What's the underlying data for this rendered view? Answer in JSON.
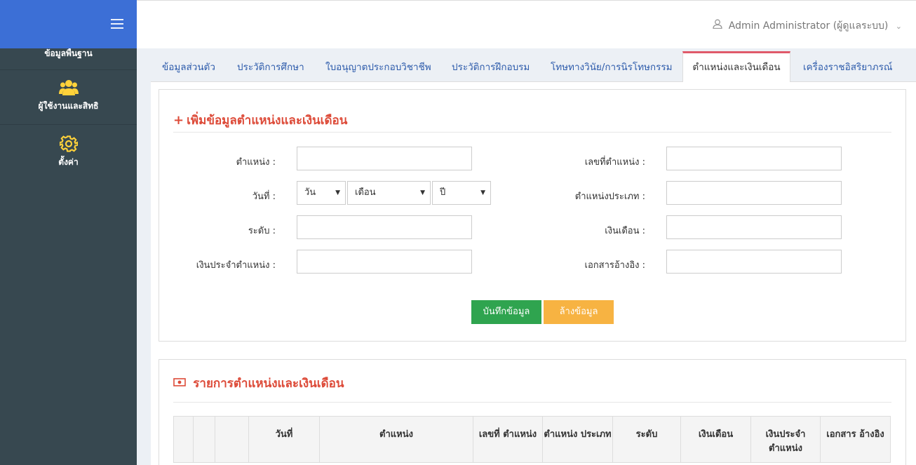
{
  "sidebar": {
    "items": [
      {
        "label": "ข้อมูลพื้นฐาน",
        "icon": "database-icon"
      },
      {
        "label": "ผู้ใช้งานและสิทธิ",
        "icon": "users-icon"
      },
      {
        "label": "ตั้งค่า",
        "icon": "gear-icon"
      }
    ]
  },
  "header": {
    "user_label": "Admin Administrator (ผู้ดูแลระบบ)"
  },
  "tabs": [
    {
      "label": "ข้อมูลส่วนตัว"
    },
    {
      "label": "ประวัติการศึกษา"
    },
    {
      "label": "ใบอนุญาตประกอบวิชาชีพ"
    },
    {
      "label": "ประวัติการฝึกอบรม"
    },
    {
      "label": "โทษทางวินัย/การนิรโทษกรรม"
    },
    {
      "label": "ตำแหน่งและเงินเดือน",
      "active": true
    },
    {
      "label": "เครื่องราชอิสริยาภรณ์"
    }
  ],
  "form": {
    "title": "เพิ่มข้อมูลตำแหน่งและเงินเดือน",
    "position_label": "ตำแหน่ง :",
    "position_no_label": "เลขที่ตำแหน่ง :",
    "date_label": "วันที่ :",
    "date_day": "วัน",
    "date_month": "เดือน",
    "date_year": "ปี",
    "position_type_label": "ตำแหน่งประเภท :",
    "level_label": "ระดับ :",
    "salary_label": "เงินเดือน :",
    "allowance_label": "เงินประจำตำแหน่ง :",
    "reference_label": "เอกสารอ้างอิง :",
    "save_button": "บันทึกข้อมูล",
    "clear_button": "ล้างข้อมูล"
  },
  "list": {
    "title": "รายการตำแหน่งและเงินเดือน",
    "columns": [
      "",
      "",
      "",
      "วันที่",
      "ตำแหน่ง",
      "เลขที่ ตำแหน่ง",
      "ตำแหน่ง ประเภท",
      "ระดับ",
      "เงินเดือน",
      "เงินประจำ ตำแหน่ง",
      "เอกสาร อ้างอิง"
    ]
  },
  "colors": {
    "sidebar_bg": "#374850",
    "sidebar_top": "#3c6fd6",
    "accent_red": "#dd4b39",
    "save_green": "#2fa44f",
    "clear_orange": "#f7b342",
    "tab_link": "#2d5bab"
  }
}
